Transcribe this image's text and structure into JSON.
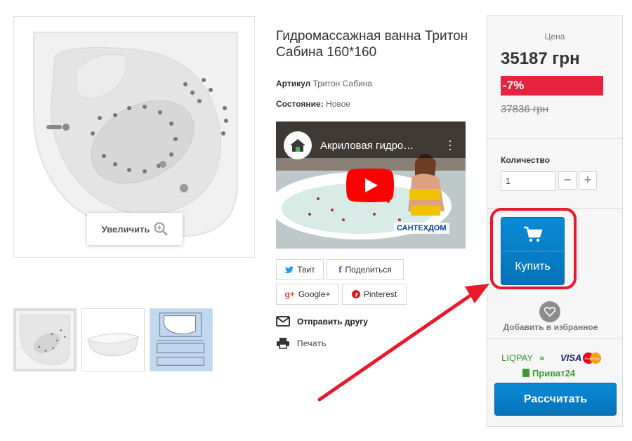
{
  "product": {
    "title": "Гидромассажная ванна Тритон Сабина 160*160",
    "article_label": "Артикул",
    "article_value": "Тритон Сабина",
    "condition_label": "Состояние:",
    "condition_value": "Новое"
  },
  "gallery": {
    "zoom_label": "Увеличить",
    "thumbnail_count": 3,
    "active_thumbnail": 1
  },
  "video": {
    "title": "Акриловая гидро…",
    "brand": "САНТЕХДОМ"
  },
  "share": {
    "tweet": "Твит",
    "facebook": "Поделиться",
    "google": "Google+",
    "pinterest": "Pinterest",
    "facebook_glyph": "f",
    "google_glyph": "g+"
  },
  "actions": {
    "send_friend": "Отправить другу",
    "print": "Печать"
  },
  "purchase": {
    "price_label": "Цена",
    "price": "35187 грн",
    "discount": "-7%",
    "old_price": "37836 грн",
    "quantity_label": "Количество",
    "quantity_value": "1",
    "minus": "−",
    "plus": "+",
    "buy": "Купить",
    "favorite": "Добавить в избранное",
    "calculate": "Рассчитать"
  },
  "payments": {
    "liqpay": "LIQPAY",
    "visa": "VISA",
    "mastercard": "MasterCard",
    "privat": "Приват24"
  },
  "colors": {
    "accent_blue": "#0a8ad6",
    "discount_red": "#e8233f",
    "annotation_red": "#e8192c"
  },
  "icons": [
    "zoom-icon",
    "twitter-icon",
    "facebook-icon",
    "google-plus-icon",
    "pinterest-icon",
    "envelope-icon",
    "printer-icon",
    "cart-icon",
    "heart-icon",
    "play-icon",
    "more-vert-icon"
  ]
}
